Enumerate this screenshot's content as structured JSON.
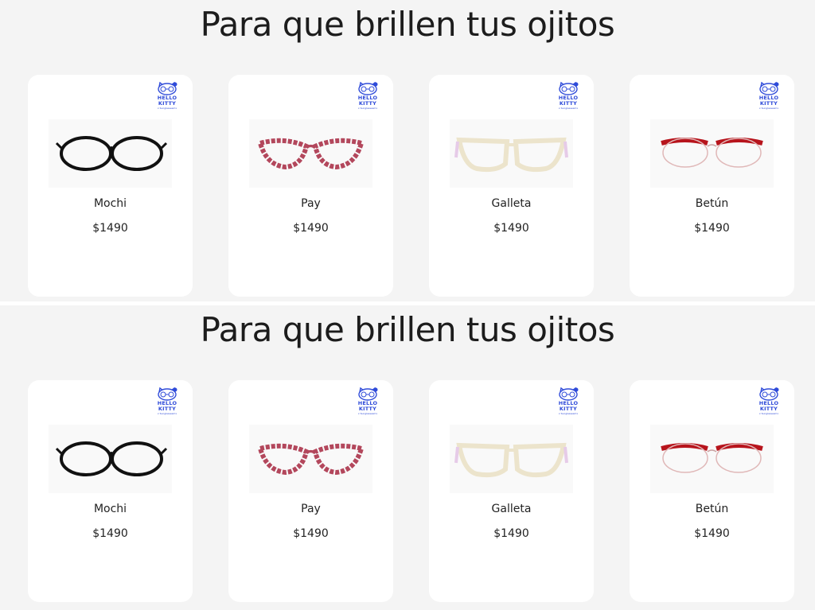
{
  "sections": [
    {
      "title": "Para que brillen tus ojitos",
      "products": [
        {
          "name": "Mochi",
          "price": "$1490",
          "frame_color": "#111111",
          "badge": {
            "line1": "HELLO",
            "line2": "KITTY",
            "sub": "x Sunglassesmx"
          }
        },
        {
          "name": "Pay",
          "price": "$1490",
          "frame_color": "#b3475c",
          "badge": {
            "line1": "HELLO",
            "line2": "KITTY",
            "sub": "x Sunglassesmx"
          }
        },
        {
          "name": "Galleta",
          "price": "$1490",
          "frame_color": "#ece4cc",
          "badge": {
            "line1": "HELLO",
            "line2": "KITTY",
            "sub": "x Sunglassesmx"
          }
        },
        {
          "name": "Betún",
          "price": "$1490",
          "frame_color": "#b7141c",
          "badge": {
            "line1": "HELLO",
            "line2": "KITTY",
            "sub": "x Sunglassesmx"
          }
        }
      ]
    },
    {
      "title": "Para que brillen tus ojitos",
      "products": [
        {
          "name": "Mochi",
          "price": "$1490",
          "frame_color": "#111111",
          "badge": {
            "line1": "HELLO",
            "line2": "KITTY",
            "sub": "x Sunglassesmx"
          }
        },
        {
          "name": "Pay",
          "price": "$1490",
          "frame_color": "#b3475c",
          "badge": {
            "line1": "HELLO",
            "line2": "KITTY",
            "sub": "x Sunglassesmx"
          }
        },
        {
          "name": "Galleta",
          "price": "$1490",
          "frame_color": "#ece4cc",
          "badge": {
            "line1": "HELLO",
            "line2": "KITTY",
            "sub": "x Sunglassesmx"
          }
        },
        {
          "name": "Betún",
          "price": "$1490",
          "frame_color": "#b7141c",
          "badge": {
            "line1": "HELLO",
            "line2": "KITTY",
            "sub": "x Sunglassesmx"
          }
        }
      ]
    }
  ],
  "icons": {
    "badge": "hello-kitty-logo-icon",
    "photo": "eyeglasses-icon"
  },
  "colors": {
    "background": "#f4f4f4",
    "card": "#ffffff",
    "text": "#1c1c1c",
    "brand_blue": "#2f4bd9"
  }
}
